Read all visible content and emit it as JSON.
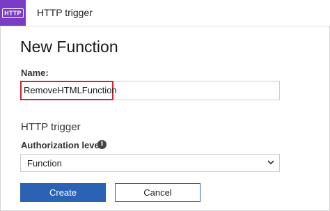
{
  "header": {
    "badge_text": "HTTP",
    "badge_icon": "http-trigger-icon",
    "title": "HTTP trigger",
    "badge_color": "#7a3cc4"
  },
  "page": {
    "title": "New Function"
  },
  "form": {
    "name_label": "Name:",
    "name_value": "RemoveHTMLFunction",
    "section_title": "HTTP trigger",
    "auth_label": "Authorization level",
    "auth_info_icon": "info-icon",
    "auth_value": "Function",
    "auth_dropdown_icon": "chevron-down-icon"
  },
  "buttons": {
    "create": "Create",
    "cancel": "Cancel"
  },
  "colors": {
    "primary": "#2a63b4",
    "highlight": "#d3222a"
  }
}
